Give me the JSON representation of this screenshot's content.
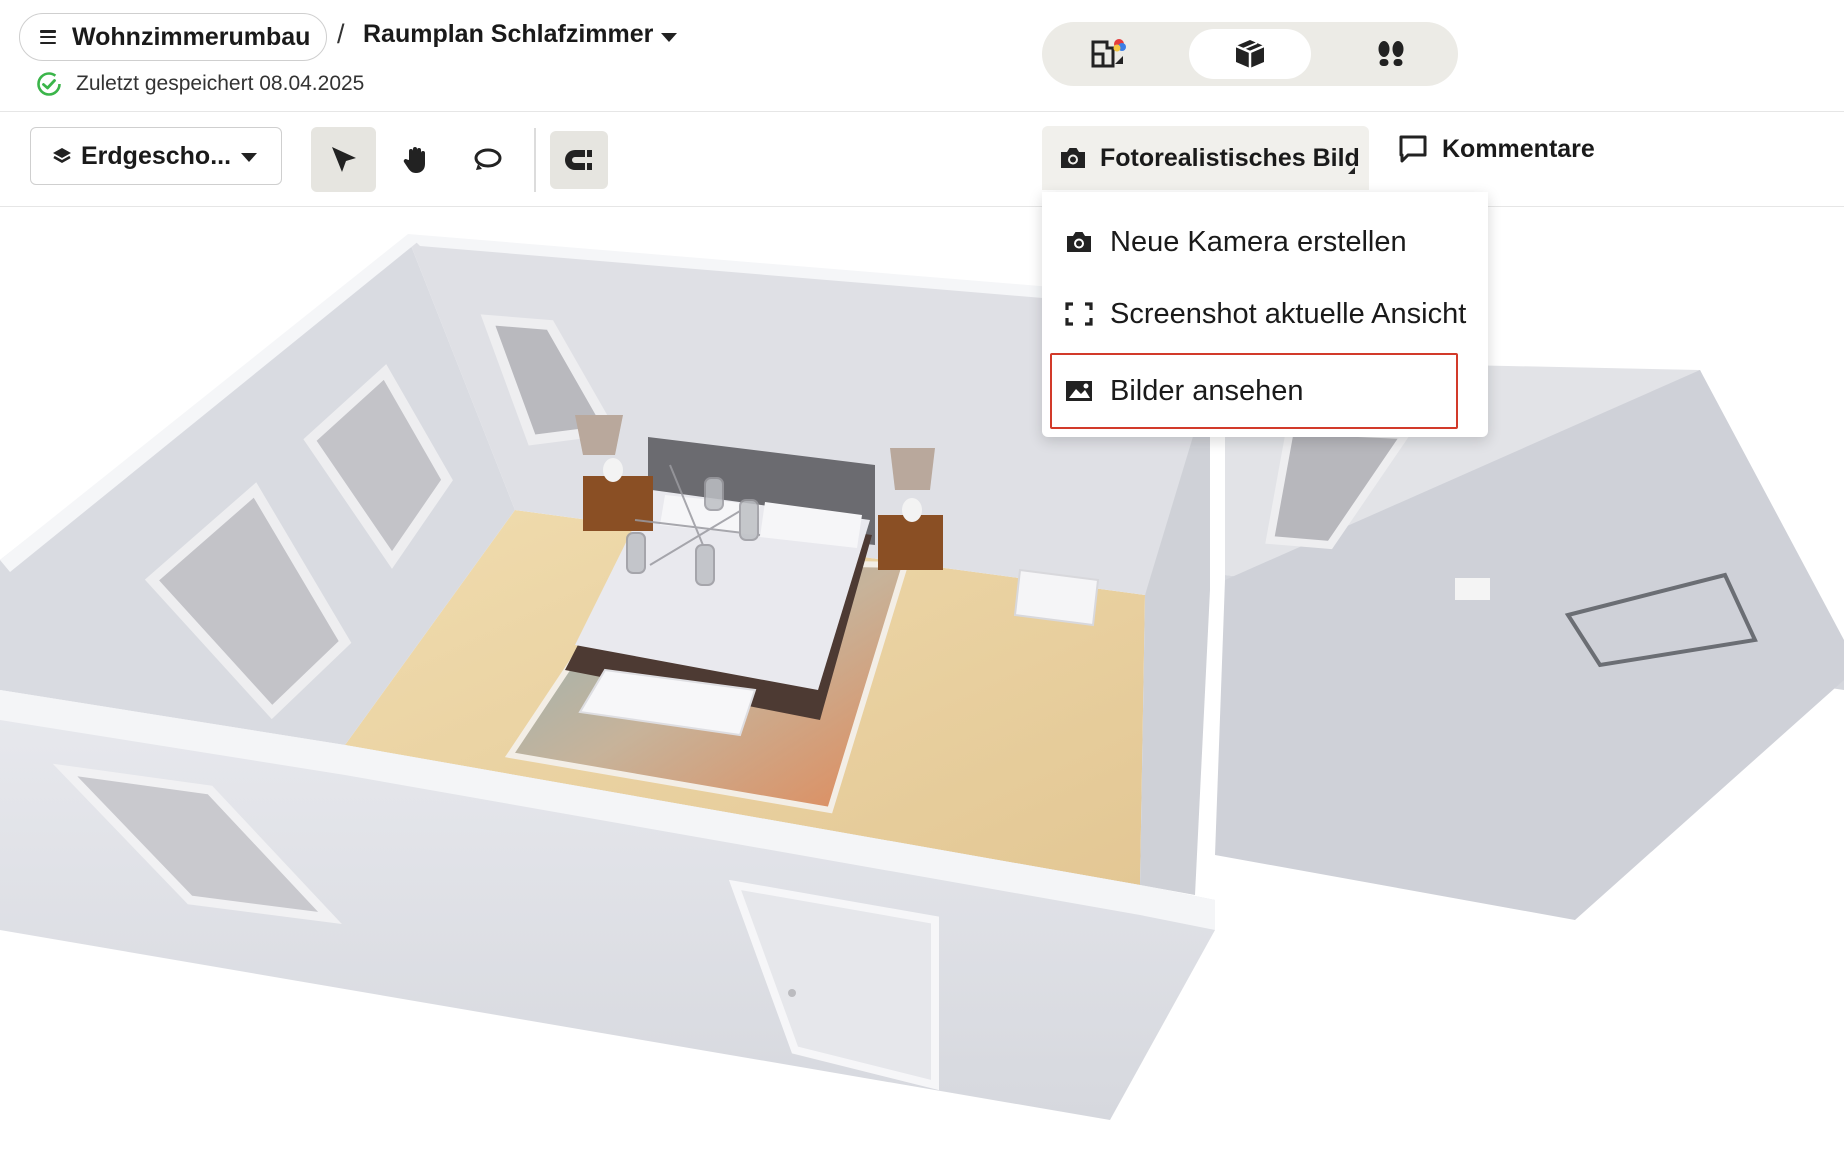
{
  "header": {
    "project_name": "Wohnzimmerumbau",
    "breadcrumb_separator": "/",
    "plan_name": "Raumplan Schlafzimmer",
    "saved_status": "Zuletzt gespeichert 08.04.2025",
    "view_modes": [
      {
        "icon": "2d-floorplan-icon",
        "active": false
      },
      {
        "icon": "3d-cube-icon",
        "active": true
      },
      {
        "icon": "walkthrough-footsteps-icon",
        "active": false
      }
    ]
  },
  "toolbar": {
    "floor_label": "Erdgescho...",
    "tools": [
      {
        "icon": "select-cursor-icon",
        "active": true
      },
      {
        "icon": "pan-hand-icon",
        "active": false
      },
      {
        "icon": "rotate-orbit-icon",
        "active": false
      },
      {
        "icon": "magnet-snap-icon",
        "active": true
      }
    ],
    "photo_label": "Fotorealistisches Bild",
    "comments_label": "Kommentare"
  },
  "dropdown": {
    "items": [
      {
        "label": "Neue Kamera erstellen",
        "icon": "camera-icon"
      },
      {
        "label": "Screenshot aktuelle Ansicht",
        "icon": "screenshot-frame-icon"
      },
      {
        "label": "Bilder ansehen",
        "icon": "image-gallery-icon",
        "highlighted": true
      }
    ]
  },
  "colors": {
    "saved_check": "#3bb54a",
    "highlight_border": "#d23a2a",
    "switch_bg": "#ecebe6",
    "floor_wood": "#e9d3a6"
  }
}
